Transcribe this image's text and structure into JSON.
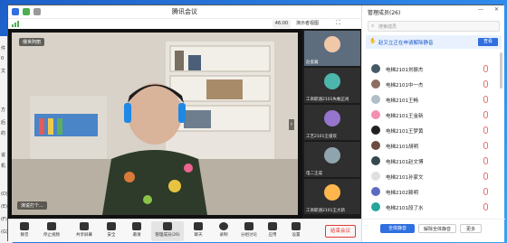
{
  "window": {
    "title": "腾讯会议"
  },
  "titlebar": {
    "timer": "46:00",
    "speaker_view": "演示者视图",
    "minimize": "—",
    "close": "✕"
  },
  "main_video": {
    "name": "俄世阿丽",
    "bottom_caption": "演说打个..."
  },
  "thumbnails": [
    {
      "name": "赵俊翼"
    },
    {
      "name": "工商职涵2101失敢正尚"
    },
    {
      "name": "工艺2101王俊欢"
    },
    {
      "name": "电二王成"
    },
    {
      "name": "工商职涵2101王大新"
    }
  ],
  "toolbar": {
    "buttons": [
      "静音",
      "停止视频",
      "共享屏幕",
      "安全",
      "邀请",
      "管理成员(26)",
      "聊天",
      "录制",
      "分组讨论",
      "应用",
      "设置"
    ],
    "end": "结束会议"
  },
  "panel": {
    "title": "管理成员(26)",
    "search_placeholder": "搜索成员",
    "notice": "赵又立正在申请解除静音",
    "notice_btn": "查看",
    "members": [
      "电梯2101刘振杰",
      "电梯2101中一杰",
      "电梯2101王畅",
      "电梯2101王金新",
      "电梯2101王梦黄",
      "电梯2101胡明",
      "电梯2101赵文博",
      "电梯2101孙家文",
      "电梯2102赖明",
      "电梯2101段了水"
    ],
    "mute_all": "全体静音",
    "unmute_all": "解除全体静音",
    "more": "更多"
  },
  "left_window": {
    "items": [
      "件",
      "0",
      "文",
      "方",
      "后",
      "的",
      "说",
      "机",
      "(D)",
      "(E)",
      "(F)",
      "(G)"
    ]
  }
}
